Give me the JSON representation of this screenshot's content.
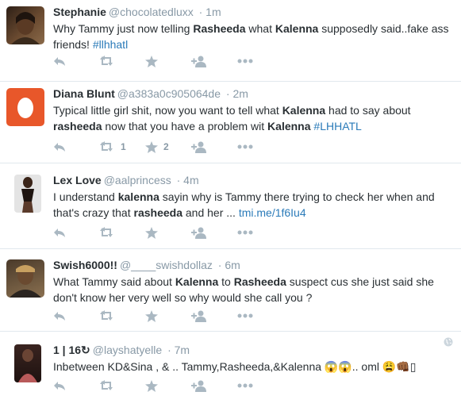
{
  "tweets": [
    {
      "name": "Stephanie",
      "handle": "@chocolatedluxx",
      "time": "· 1m",
      "segments": [
        {
          "t": "Why Tammy just now telling "
        },
        {
          "t": "Rasheeda",
          "b": true
        },
        {
          "t": " what "
        },
        {
          "t": "Kalenna",
          "b": true
        },
        {
          "t": " supposedly said..fake ass friends! "
        },
        {
          "t": "#llhhatl",
          "tag": true
        }
      ],
      "retweets": "",
      "favorites": "",
      "avatar_colors": [
        "#3b2a1e",
        "#6b4a2e"
      ]
    },
    {
      "name": "Diana Blunt",
      "handle": "@a383a0c905064de",
      "time": "· 2m",
      "segments": [
        {
          "t": "Typical little girl shit, now you want to tell what "
        },
        {
          "t": "Kalenna",
          "b": true
        },
        {
          "t": " had to say about "
        },
        {
          "t": "rasheeda",
          "b": true
        },
        {
          "t": " now that you have a problem wit "
        },
        {
          "t": "Kalenna",
          "b": true
        },
        {
          "t": " "
        },
        {
          "t": "#LHHATL",
          "tag": true
        }
      ],
      "retweets": "1",
      "favorites": "2",
      "avatar_colors": [
        "#e8572a",
        "#ffffff"
      ]
    },
    {
      "name": "Lex Love",
      "handle": "@aalprincess",
      "time": "· 4m",
      "segments": [
        {
          "t": "I understand "
        },
        {
          "t": "kalenna",
          "b": true
        },
        {
          "t": " sayin why is Tammy there trying to check her when and that's crazy that "
        },
        {
          "t": "rasheeda",
          "b": true
        },
        {
          "t": " and her ... "
        },
        {
          "t": "tmi.me/1f6Iu4",
          "link": true
        }
      ],
      "retweets": "",
      "favorites": "",
      "avatar_colors": [
        "#d8d8d8",
        "#3a2a22"
      ]
    },
    {
      "name": "Swish6000!!",
      "handle": "@____swishdollaz",
      "time": "· 6m",
      "segments": [
        {
          "t": "What Tammy said about "
        },
        {
          "t": "Kalenna",
          "b": true
        },
        {
          "t": " to "
        },
        {
          "t": "Rasheeda",
          "b": true
        },
        {
          "t": " suspect cus she just said she don't know her very well so why would she call you ?"
        }
      ],
      "retweets": "",
      "favorites": "",
      "avatar_colors": [
        "#4a3a2a",
        "#c8a060"
      ]
    },
    {
      "name": "1 | 16↻",
      "handle": "@layshatyelle",
      "time": "· 7m",
      "segments": [
        {
          "t": "Inbetween KD&Sina , & .. Tammy,Rasheeda,&Kalenna 😱😱.. oml 😩👊🏾▯"
        }
      ],
      "retweets": "",
      "favorites": "",
      "avatar_colors": [
        "#2a1a16",
        "#c86a6a"
      ]
    }
  ]
}
